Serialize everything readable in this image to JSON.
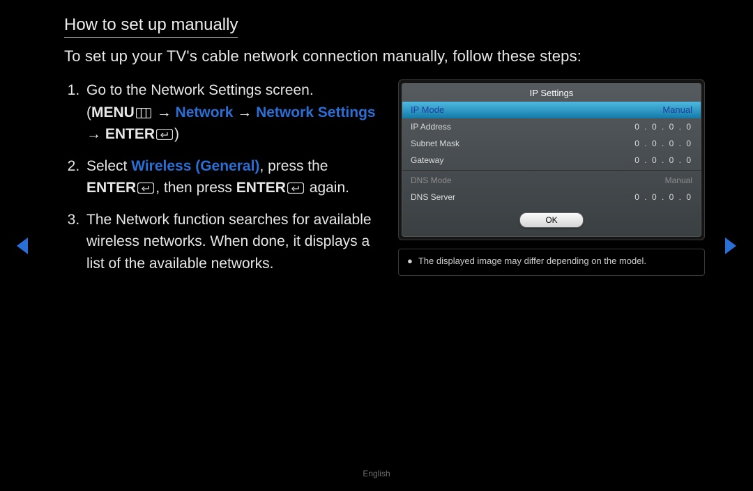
{
  "title": "How to set up manually",
  "intro": "To set up your TV's cable network connection manually, follow these steps:",
  "steps": {
    "s1": {
      "a": "Go to the Network Settings screen.",
      "menu": "MENU",
      "nav1": "Network",
      "nav2": "Network Settings",
      "enter": "ENTER"
    },
    "s2": {
      "a": "Select ",
      "wg": "Wireless (General)",
      "b": ", press the ",
      "enter": "ENTER",
      "c": ", then press ",
      "enter2": "ENTER",
      "d": " again."
    },
    "s3": "The Network function searches for available wireless networks. When done, it displays a list of the available networks."
  },
  "panel": {
    "title": "IP Settings",
    "highlight": {
      "label": "IP Mode",
      "value": "Manual"
    },
    "rows": [
      {
        "label": "IP Address",
        "value": "0 . 0 . 0 . 0"
      },
      {
        "label": "Subnet Mask",
        "value": "0 . 0 . 0 . 0"
      },
      {
        "label": "Gateway",
        "value": "0 . 0 . 0 . 0"
      }
    ],
    "dns_mode": {
      "label": "DNS Mode",
      "value": "Manual"
    },
    "dns_server": {
      "label": "DNS Server",
      "value": "0 . 0 . 0 . 0"
    },
    "ok": "OK"
  },
  "note": "The displayed image may differ depending on the model.",
  "footer": "English"
}
